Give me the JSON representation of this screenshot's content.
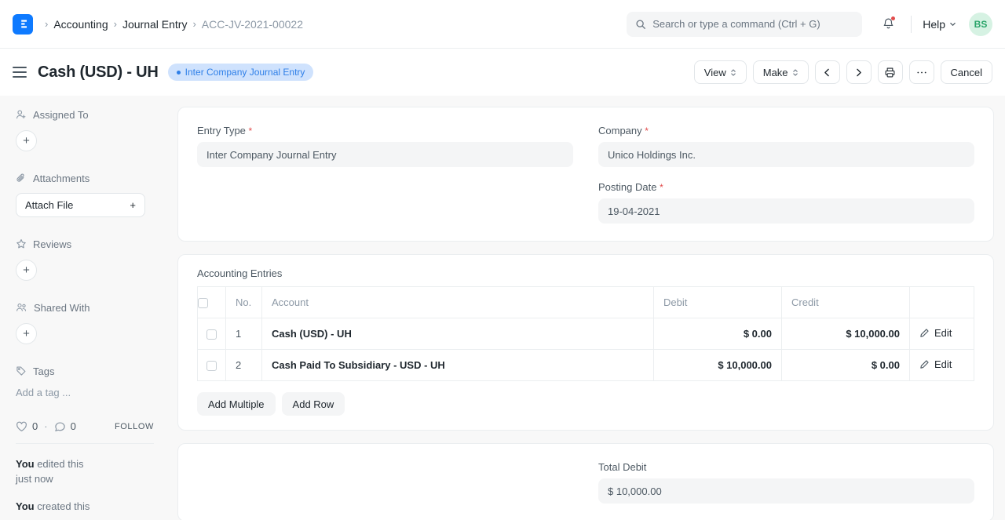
{
  "navbar": {
    "logo_icon": "frappe-logo-icon",
    "breadcrumb": [
      {
        "label": "Accounting",
        "current": false
      },
      {
        "label": "Journal Entry",
        "current": false
      },
      {
        "label": "ACC-JV-2021-00022",
        "current": true
      }
    ],
    "search": {
      "icon": "search-icon",
      "placeholder": "Search or type a command (Ctrl + G)",
      "value": ""
    },
    "notifications": {
      "icon": "bell-icon",
      "has_unread": true,
      "dot_color": "#e24c4c"
    },
    "help": {
      "label": "Help",
      "icon": "chevron-down-icon"
    },
    "avatar": {
      "initials": "BS",
      "bg": "#d6f2e3",
      "fg": "#29a469"
    }
  },
  "page_header": {
    "menu_icon": "hamburger-icon",
    "title": "Cash (USD) - UH",
    "status": {
      "label": "Inter Company Journal Entry",
      "bg": "#cfe2fd",
      "fg": "#2e7fe8"
    },
    "actions": {
      "view": "View",
      "make": "Make",
      "prev_icon": "chevron-left-icon",
      "next_icon": "chevron-right-icon",
      "print_icon": "printer-icon",
      "more_icon": "ellipsis-icon",
      "cancel": "Cancel"
    }
  },
  "sidebar": {
    "sections": [
      {
        "title": "Assigned To",
        "icon": "user-plus-icon",
        "control": "plus-circle"
      },
      {
        "title": "Attachments",
        "icon": "paperclip-icon",
        "control": "attach-file",
        "button_label": "Attach File"
      },
      {
        "title": "Reviews",
        "icon": "star-icon",
        "control": "plus-circle"
      },
      {
        "title": "Shared With",
        "icon": "users-icon",
        "control": "plus-circle"
      },
      {
        "title": "Tags",
        "icon": "tag-icon",
        "control": "tag-input",
        "placeholder": "Add a tag ..."
      }
    ],
    "social": {
      "like_icon": "heart-icon",
      "like_count": "0",
      "separator": "·",
      "comment_icon": "comment-icon",
      "comment_count": "0",
      "follow_label": "FOLLOW"
    },
    "activity": [
      {
        "actor": "You",
        "text": " edited this",
        "time": "just now"
      },
      {
        "actor": "You",
        "text": " created this",
        "time": ""
      }
    ]
  },
  "main": {
    "fields": {
      "entry_type": {
        "label": "Entry Type",
        "required": true,
        "value": "Inter Company Journal Entry"
      },
      "company": {
        "label": "Company",
        "required": true,
        "value": "Unico Holdings Inc."
      },
      "posting_date": {
        "label": "Posting Date",
        "required": true,
        "value": "19-04-2021"
      }
    },
    "grid": {
      "label": "Accounting Entries",
      "columns": [
        "No.",
        "Account",
        "Debit",
        "Credit",
        ""
      ],
      "rows": [
        {
          "no": "1",
          "account": "Cash (USD) - UH",
          "debit": "$ 0.00",
          "credit": "$ 10,000.00",
          "edit": "Edit"
        },
        {
          "no": "2",
          "account": "Cash Paid To Subsidiary - USD - UH",
          "debit": "$ 10,000.00",
          "credit": "$ 0.00",
          "edit": "Edit"
        }
      ],
      "add_multiple": "Add Multiple",
      "add_row": "Add Row"
    },
    "totals": {
      "total_debit": {
        "label": "Total Debit",
        "value": "$ 10,000.00"
      }
    }
  }
}
